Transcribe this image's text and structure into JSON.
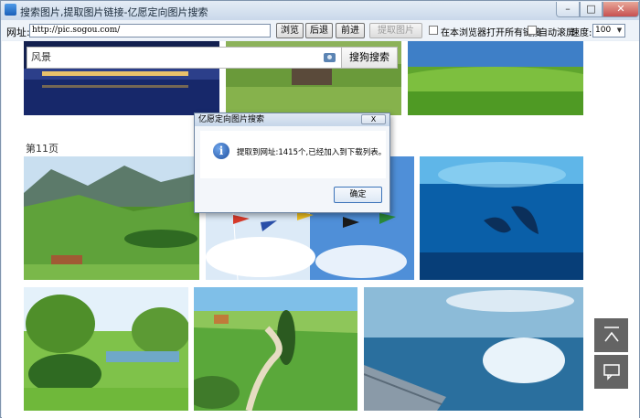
{
  "window": {
    "title": "搜索图片,提取图片链接-亿愿定向图片搜索",
    "min_symbol": "–",
    "max_symbol": "□",
    "close_symbol": "✕"
  },
  "toolbar": {
    "url_label": "网址:",
    "url_value": "http://pic.sogou.com/",
    "browse_label": "浏览",
    "back_label": "后退",
    "forward_label": "前进",
    "extract_label": "提取图片",
    "open_all_label": "在本浏览器打开所有链接",
    "auto_scroll_label": "自动滚屏",
    "speed_label": "速度:",
    "speed_value": "100",
    "speed_arrow": "▼"
  },
  "search": {
    "query": "风景",
    "button_label": "搜狗搜索"
  },
  "results": {
    "page_label": "第11页"
  },
  "dialog": {
    "title": "亿愿定向图片搜索",
    "close_symbol": "X",
    "info_symbol": "i",
    "message": "提取到网址:1415个,已经加入到下载列表。",
    "ok_label": "确定"
  },
  "side": {
    "top_icon": "back-to-top-icon",
    "feedback_icon": "feedback-icon"
  }
}
